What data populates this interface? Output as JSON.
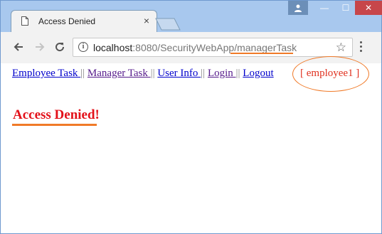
{
  "browser": {
    "tab_title": "Access Denied",
    "tab_close": "×",
    "url_host": "localhost",
    "url_rest": ":8080/SecurityWebApp/managerTask"
  },
  "window_controls": {
    "minimize": "—",
    "maximize": "☐",
    "close": "✕"
  },
  "page": {
    "menu": [
      {
        "label": "Employee Task ",
        "visited": false
      },
      {
        "label": "Manager Task ",
        "visited": true
      },
      {
        "label": "User Info ",
        "visited": false
      },
      {
        "label": "Login ",
        "visited": true
      },
      {
        "label": "Logout",
        "visited": false
      }
    ],
    "separator": "||",
    "user_tag": "[ employee1 ]",
    "heading": "Access Denied!"
  },
  "colors": {
    "annotation": "#f07a28",
    "heading": "#e3111a",
    "user_tag": "#e0301e",
    "link": "#0000cc"
  }
}
